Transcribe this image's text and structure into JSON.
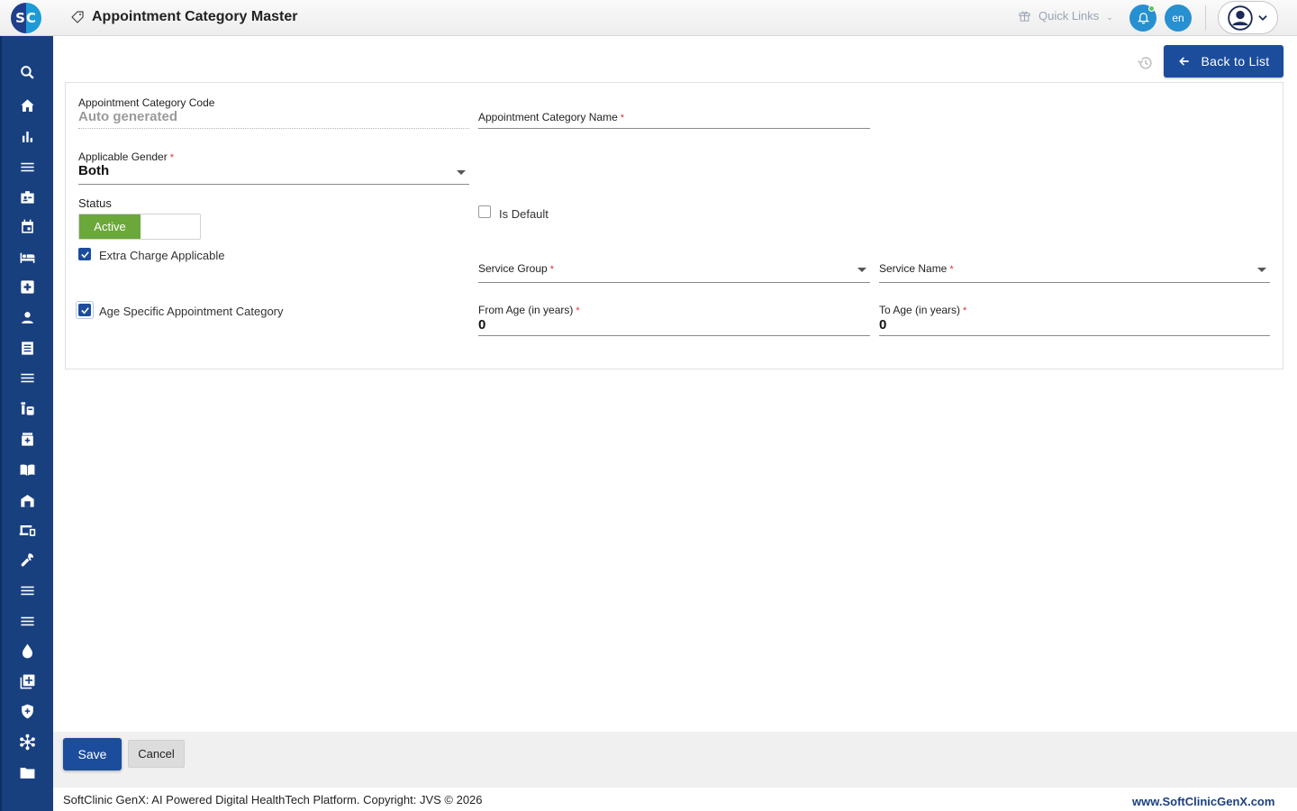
{
  "header": {
    "logo_text": "SC",
    "page_title": "Appointment Category Master",
    "quick_links": "Quick Links",
    "lang": "en"
  },
  "actions": {
    "back_to_list": "Back to List",
    "save": "Save",
    "cancel": "Cancel"
  },
  "form": {
    "category_code": {
      "label": "Appointment Category Code",
      "value": "Auto generated"
    },
    "category_name": {
      "label": "Appointment Category Name",
      "required": "*",
      "value": ""
    },
    "applicable_gender": {
      "label": "Applicable Gender",
      "required": "*",
      "value": "Both"
    },
    "status": {
      "label": "Status",
      "value": "Active"
    },
    "is_default": {
      "label": "Is Default",
      "checked": false
    },
    "extra_charge": {
      "label": "Extra Charge Applicable",
      "checked": true
    },
    "service_group": {
      "label": "Service Group",
      "required": "*",
      "value": ""
    },
    "service_name": {
      "label": "Service Name",
      "required": "*",
      "value": ""
    },
    "age_specific": {
      "label": "Age Specific Appointment Category",
      "checked": true
    },
    "from_age": {
      "label": "From Age (in years)",
      "required": "*",
      "value": "0"
    },
    "to_age": {
      "label": "To Age (in years)",
      "required": "*",
      "value": "0"
    }
  },
  "sidebar": {
    "icons": [
      "search-icon",
      "home-icon",
      "bar-chart-icon",
      "menu-icon",
      "badge-icon",
      "calendar-icon",
      "bed-icon",
      "medical-plus-icon",
      "person-icon",
      "receipt-icon",
      "list-icon",
      "vials-icon",
      "medicine-icon",
      "book-icon",
      "store-icon",
      "devices-icon",
      "wrench-icon",
      "menu-icon",
      "list-icon",
      "drop-icon",
      "add-box-icon",
      "shield-icon",
      "hub-icon",
      "folder-icon"
    ]
  },
  "footer": {
    "copyright": "SoftClinic GenX: AI Powered Digital HealthTech Platform. Copyright: JVS © 2026",
    "website": "www.SoftClinicGenX.com"
  },
  "colors": {
    "primary": "#1c4d9c",
    "sidebar": "#18407f",
    "active_green": "#6aa83a",
    "notification": "#2790d0"
  }
}
